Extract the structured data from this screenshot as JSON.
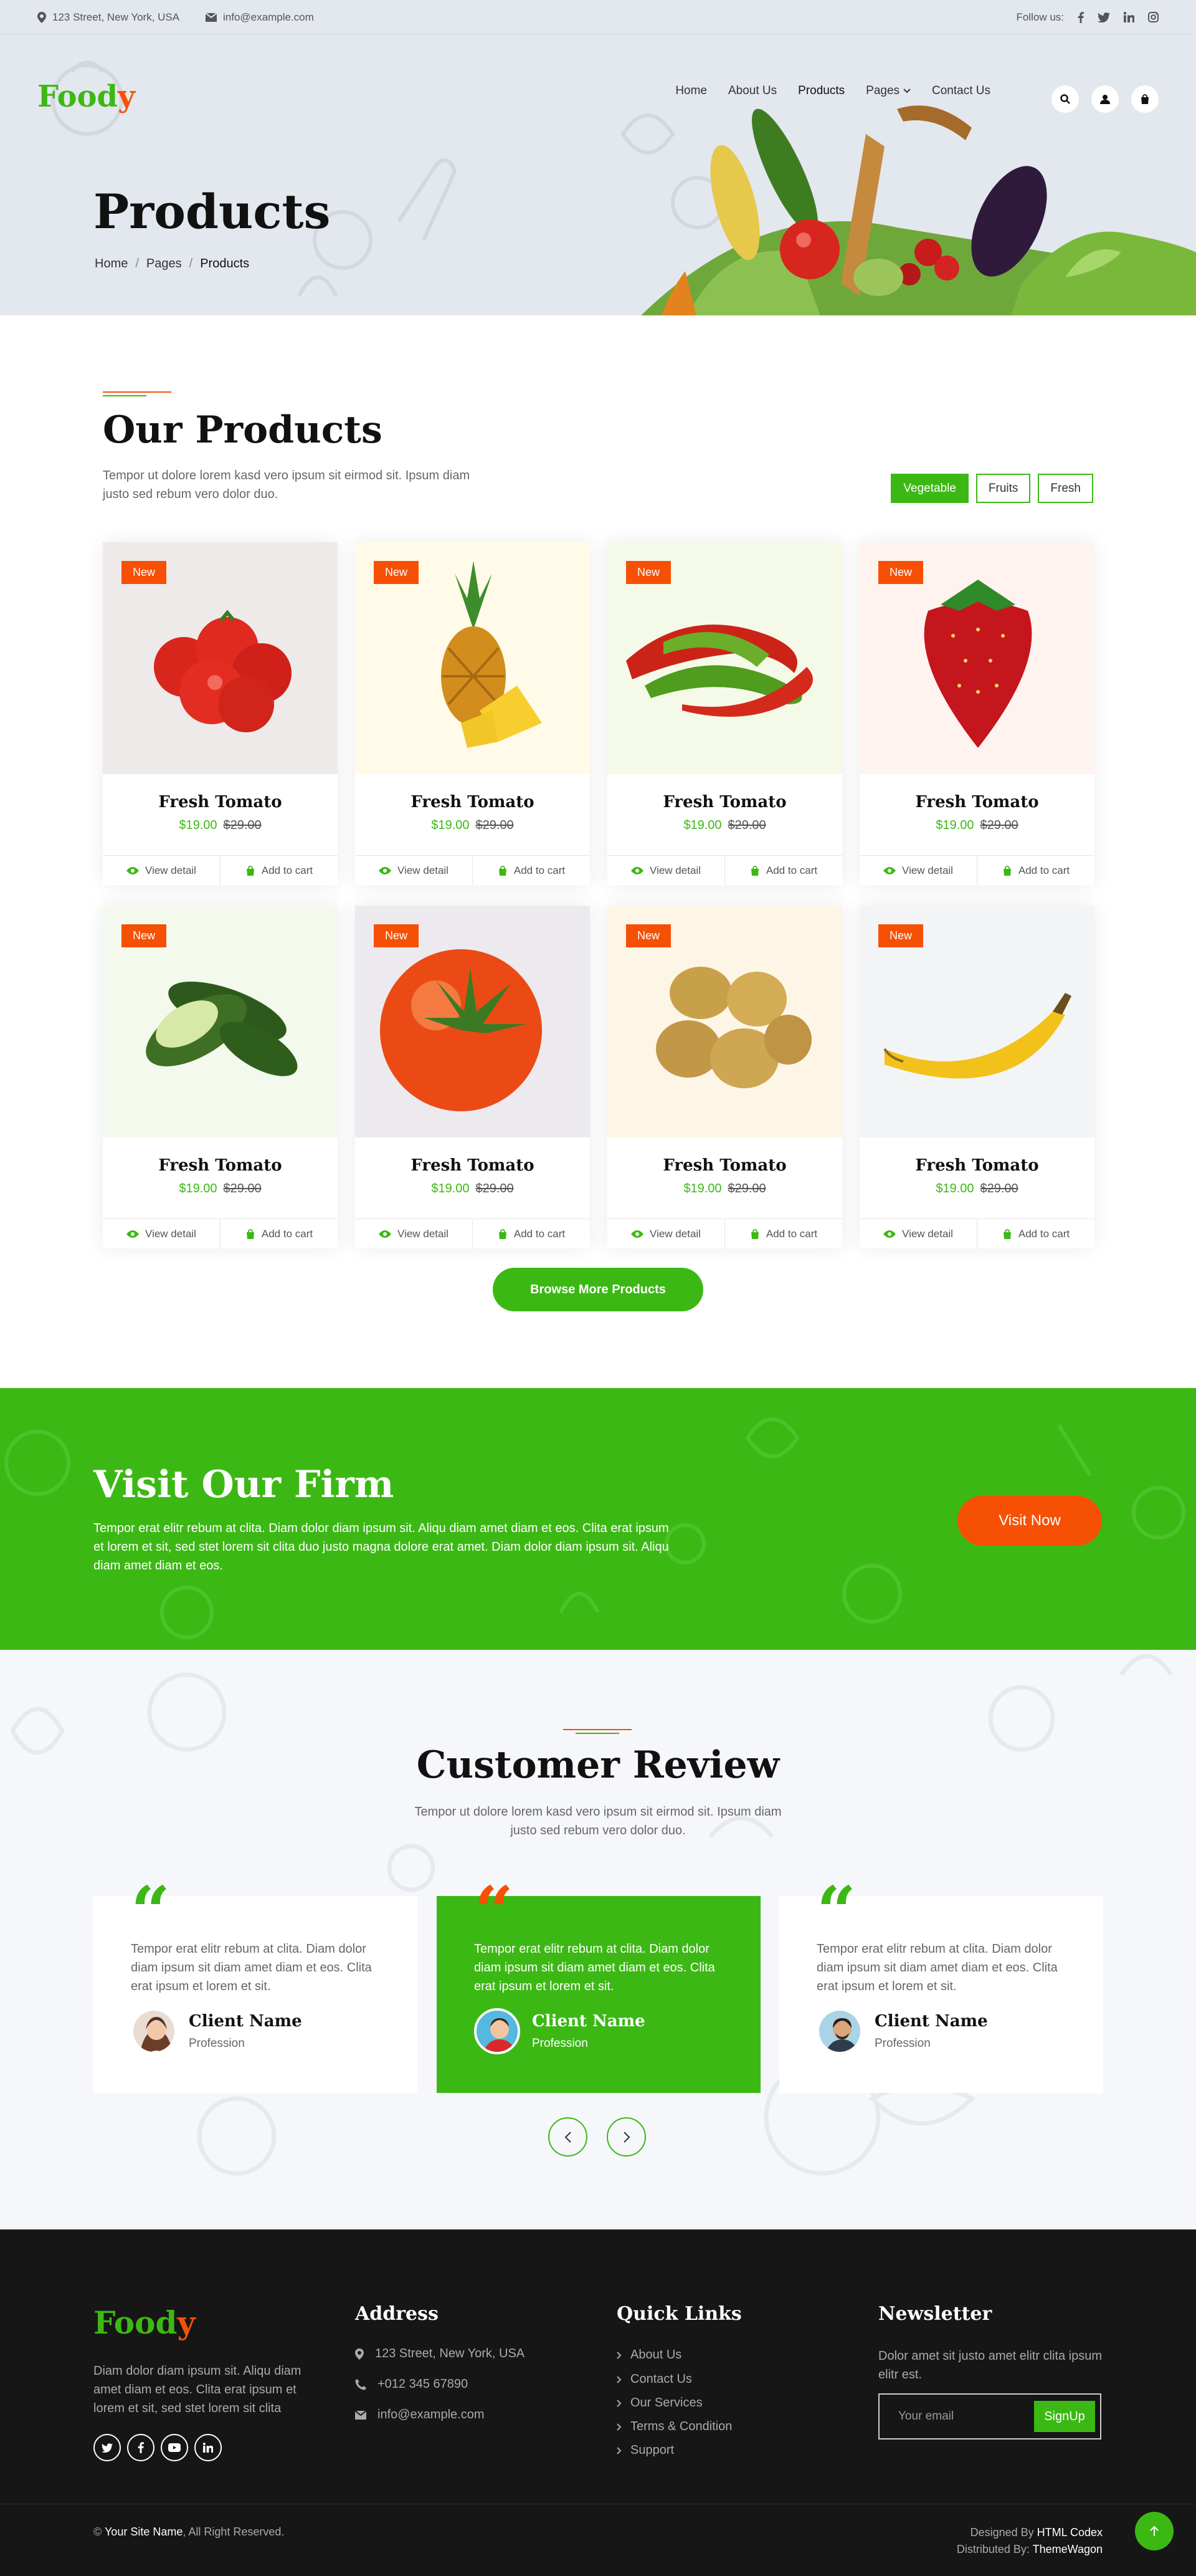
{
  "topbar": {
    "address": "123 Street, New York, USA",
    "email": "info@example.com",
    "follow_label": "Follow us:"
  },
  "brand": {
    "name_main": "Food",
    "name_accent": "y",
    "color_primary": "#3cb815",
    "color_accent": "#f65005"
  },
  "nav": {
    "items": [
      "Home",
      "About Us",
      "Products",
      "Pages",
      "Contact Us"
    ],
    "active": "Products"
  },
  "hero": {
    "title": "Products",
    "breadcrumb": [
      "Home",
      "Pages",
      "Products"
    ]
  },
  "products": {
    "title": "Our Products",
    "description": "Tempor ut dolore lorem kasd vero ipsum sit eirmod sit. Ipsum diam justo sed rebum vero dolor duo.",
    "filters": [
      "Vegetable",
      "Fruits",
      "Fresh"
    ],
    "active_filter": "Vegetable",
    "badge": "New",
    "view_label": "View detail",
    "cart_label": "Add to cart",
    "items": [
      {
        "name": "Fresh Tomato",
        "price": "$19.00",
        "old_price": "$29.00",
        "image": "tomatoes"
      },
      {
        "name": "Fresh Tomato",
        "price": "$19.00",
        "old_price": "$29.00",
        "image": "pineapple"
      },
      {
        "name": "Fresh Tomato",
        "price": "$19.00",
        "old_price": "$29.00",
        "image": "chili-peppers"
      },
      {
        "name": "Fresh Tomato",
        "price": "$19.00",
        "old_price": "$29.00",
        "image": "strawberry"
      },
      {
        "name": "Fresh Tomato",
        "price": "$19.00",
        "old_price": "$29.00",
        "image": "cucumbers"
      },
      {
        "name": "Fresh Tomato",
        "price": "$19.00",
        "old_price": "$29.00",
        "image": "tomato"
      },
      {
        "name": "Fresh Tomato",
        "price": "$19.00",
        "old_price": "$29.00",
        "image": "potatoes"
      },
      {
        "name": "Fresh Tomato",
        "price": "$19.00",
        "old_price": "$29.00",
        "image": "banana"
      }
    ],
    "browse_label": "Browse More Products"
  },
  "firm": {
    "title": "Visit Our Firm",
    "text": "Tempor erat elitr rebum at clita. Diam dolor diam ipsum sit. Aliqu diam amet diam et eos. Clita erat ipsum et lorem et sit, sed stet lorem sit clita duo justo magna dolore erat amet. Diam dolor diam ipsum sit. Aliqu diam amet diam et eos.",
    "button": "Visit Now"
  },
  "reviews": {
    "title": "Customer Review",
    "description": "Tempor ut dolore lorem kasd vero ipsum sit eirmod sit. Ipsum diam justo sed rebum vero dolor duo.",
    "items": [
      {
        "text": "Tempor erat elitr rebum at clita. Diam dolor diam ipsum sit diam amet diam et eos. Clita erat ipsum et lorem et sit.",
        "name": "Client Name",
        "profession": "Profession"
      },
      {
        "text": "Tempor erat elitr rebum at clita. Diam dolor diam ipsum sit diam amet diam et eos. Clita erat ipsum et lorem et sit.",
        "name": "Client Name",
        "profession": "Profession"
      },
      {
        "text": "Tempor erat elitr rebum at clita. Diam dolor diam ipsum sit diam amet diam et eos. Clita erat ipsum et lorem et sit.",
        "name": "Client Name",
        "profession": "Profession"
      }
    ]
  },
  "footer": {
    "about": "Diam dolor diam ipsum sit. Aliqu diam amet diam et eos. Clita erat ipsum et lorem et sit, sed stet lorem sit clita",
    "address_title": "Address",
    "address": "123 Street, New York, USA",
    "phone": "+012 345 67890",
    "email": "info@example.com",
    "links_title": "Quick Links",
    "links": [
      "About Us",
      "Contact Us",
      "Our Services",
      "Terms & Condition",
      "Support"
    ],
    "newsletter_title": "Newsletter",
    "newsletter_text": "Dolor amet sit justo amet elitr clita ipsum elitr est.",
    "newsletter_placeholder": "Your email",
    "newsletter_button": "SignUp",
    "copyright_site": "Your Site Name",
    "copyright_rest": ", All Right Reserved.",
    "designed_prefix": "Designed By ",
    "designed_by": "HTML Codex",
    "distributed_prefix": "Distributed By: ",
    "distributed_by": "ThemeWagon"
  }
}
